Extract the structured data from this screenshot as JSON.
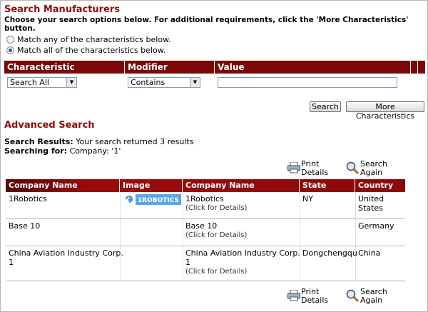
{
  "header": {
    "title": "Search Manufacturers",
    "subtitle": "Choose your search options below. For additional requirements, click the 'More Characteristics' button."
  },
  "match_options": [
    {
      "label": "Match any of the characteristics below.",
      "selected": false
    },
    {
      "label": "Match all of the characteristics below.",
      "selected": true
    }
  ],
  "criteria_table": {
    "headers": [
      "Characteristic",
      "Modifier",
      "Value"
    ],
    "characteristic_value": "Search All",
    "modifier_value": "Contains",
    "value": ""
  },
  "buttons": {
    "search": "Search",
    "more": "More Characteristics"
  },
  "advanced": {
    "title": "Advanced Search",
    "results_label": "Search Results:",
    "results_text": "Your search returned 3 results",
    "searching_label": "Searching for:",
    "searching_text": "Company: '1'"
  },
  "actions": {
    "print_line1": "Print",
    "print_line2": "Details",
    "search_line1": "Search",
    "search_line2": "Again"
  },
  "results_table": {
    "headers": [
      "Company Name",
      "Image",
      "Company Name",
      "State",
      "Country"
    ],
    "rows": [
      {
        "name": "1Robotics",
        "detail_name": "1Robotics",
        "detail_link": "(Click for Details)",
        "state": "NY",
        "country_line1": "United",
        "country_line2": "States",
        "logo_text": "1ROBOTICS"
      },
      {
        "name": "Base 10",
        "detail_name": "Base 10",
        "detail_link": "(Click for Details)",
        "state": "",
        "country_line1": "Germany",
        "country_line2": ""
      },
      {
        "name_line1": "China Aviation Industry Corp.",
        "name_line2": "1",
        "detail_name_line1": "China Aviation Industry Corp.",
        "detail_name_line2": "1",
        "detail_link": "(Click for Details)",
        "state": "Dongchengqu",
        "country_line1": "China",
        "country_line2": ""
      }
    ]
  },
  "colors": {
    "accent": "#8b0d0d",
    "bar": "#7a0808"
  }
}
